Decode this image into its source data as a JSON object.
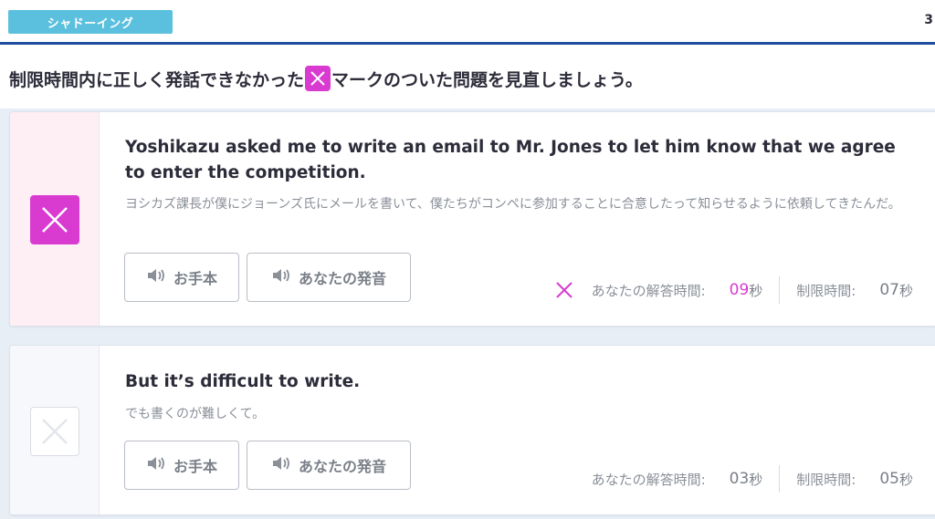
{
  "header": {
    "tag": "シャドーイング",
    "edge_text": "3"
  },
  "instruction": {
    "before": "制限時間内に正しく発話できなかった",
    "after": "マークのついた問題を見直しましょう。"
  },
  "buttons": {
    "model": "お手本",
    "yours": "あなたの発音"
  },
  "labels": {
    "your_time": "あなたの解答時間:",
    "limit": "制限時間:",
    "unit": "秒"
  },
  "items": [
    {
      "status": "incorrect",
      "english": "Yoshikazu asked me to write an email to Mr. Jones to let him know that we agree to enter the competition.",
      "japanese": "ヨシカズ課長が僕にジョーンズ氏にメールを書いて、僕たちがコンペに参加することに合意したって知らせるように依頼してきたんだ。",
      "your_time": "09",
      "limit_time": "07"
    },
    {
      "status": "correct",
      "english": "But it’s difficult to write.",
      "japanese": "でも書くのが難しくて。",
      "your_time": "03",
      "limit_time": "05"
    }
  ],
  "colors": {
    "accent": "#d93bd0",
    "header_tag": "#5bc0de",
    "header_line": "#1f4ea0"
  }
}
